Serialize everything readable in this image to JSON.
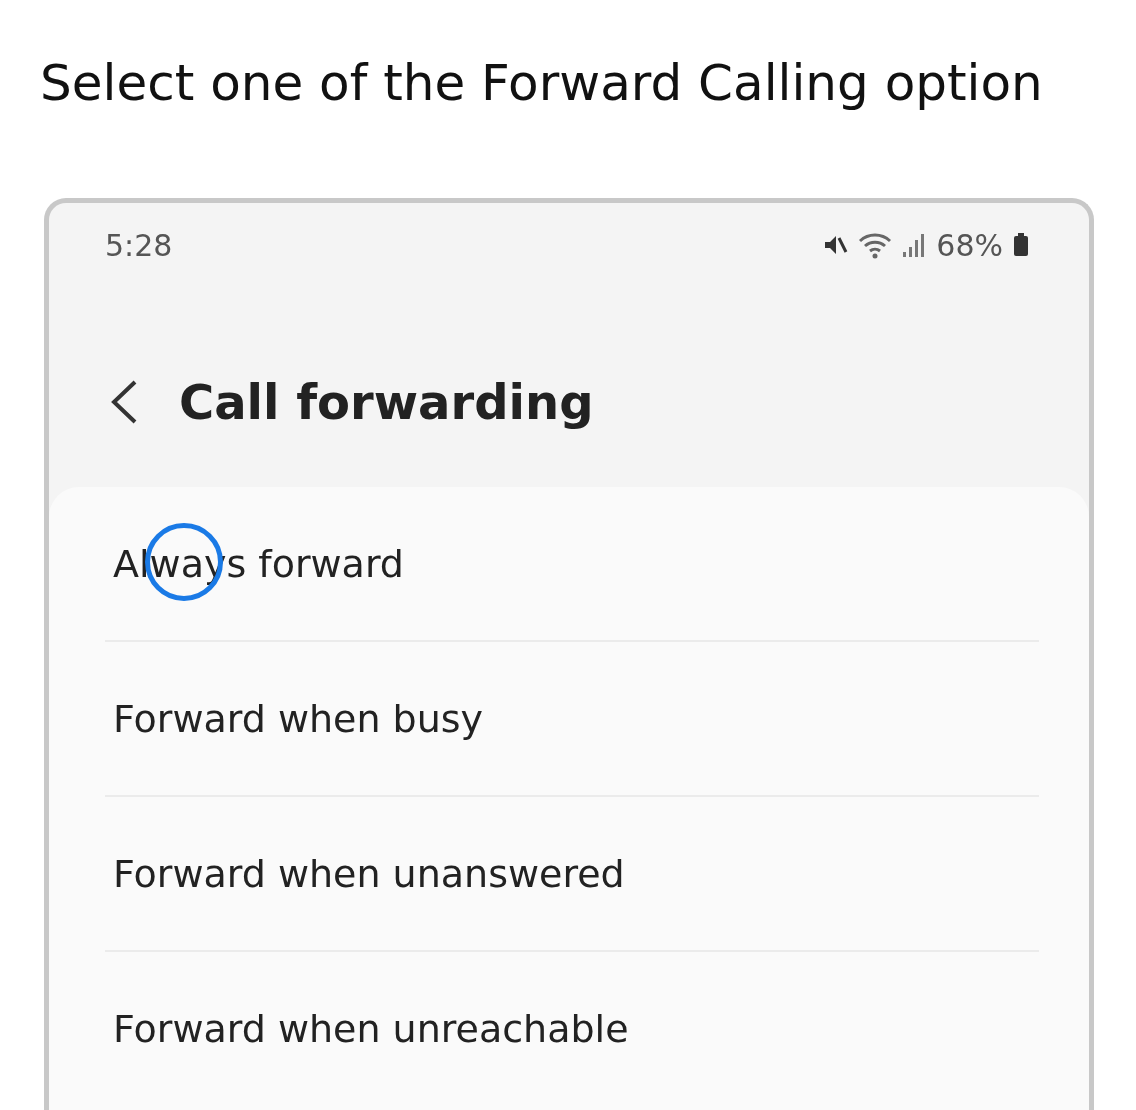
{
  "heading": "Select one of the Forward Calling option",
  "status_bar": {
    "time": "5:28",
    "battery": "68%"
  },
  "app_bar": {
    "title": "Call forwarding"
  },
  "options": [
    {
      "label": "Always forward",
      "tapped": true
    },
    {
      "label": "Forward when busy",
      "tapped": false
    },
    {
      "label": "Forward when unanswered",
      "tapped": false
    },
    {
      "label": "Forward when unreachable",
      "tapped": false
    }
  ]
}
